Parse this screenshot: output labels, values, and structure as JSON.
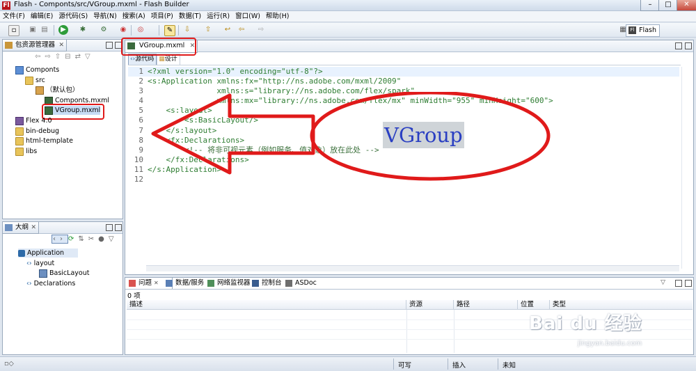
{
  "window": {
    "title": "Flash - Componts/src/VGroup.mxml - Flash Builder",
    "logo": "Fl",
    "controls": [
      "–",
      "□",
      "✕"
    ]
  },
  "menu": [
    "文件(F)",
    "编辑(E)",
    "源代码(S)",
    "导航(N)",
    "搜索(A)",
    "项目(P)",
    "数据(T)",
    "运行(R)",
    "窗口(W)",
    "帮助(H)"
  ],
  "toolbar": {
    "perspective_label": "Flash",
    "perspective_icon": "Fl"
  },
  "package_explorer": {
    "tab_label": "包资源管理器",
    "tree": [
      {
        "label": "Componts",
        "icon": "project-icon"
      },
      {
        "label": "src",
        "icon": "folder-icon"
      },
      {
        "label": "（默认包）",
        "icon": "package-icon"
      },
      {
        "label": "Componts.mxml",
        "icon": "mxml-file-icon"
      },
      {
        "label": "VGroup.mxml",
        "icon": "mxml-file-icon"
      },
      {
        "label": "Flex 4.0",
        "icon": "library-icon"
      },
      {
        "label": "bin-debug",
        "icon": "folder-icon"
      },
      {
        "label": "html-template",
        "icon": "folder-icon"
      },
      {
        "label": "libs",
        "icon": "folder-icon"
      }
    ]
  },
  "outline": {
    "tab_label": "大纲",
    "tree": [
      {
        "label": "Application"
      },
      {
        "label": "layout"
      },
      {
        "label": "BasicLayout"
      },
      {
        "label": "Declarations"
      }
    ]
  },
  "editor": {
    "tab_label": "VGroup.mxml",
    "mode_source": "源代码",
    "mode_design": "设计",
    "lines": [
      {
        "n": "1",
        "text": "<?xml version=\"1.0\" encoding=\"utf-8\"?>"
      },
      {
        "n": "2",
        "text": "<s:Application xmlns:fx=\"http://ns.adobe.com/mxml/2009\""
      },
      {
        "n": "3",
        "text": "               xmlns:s=\"library://ns.adobe.com/flex/spark\""
      },
      {
        "n": "4",
        "text": "               xmlns:mx=\"library://ns.adobe.com/flex/mx\" minWidth=\"955\" minHeight=\"600\">"
      },
      {
        "n": "5",
        "text": "    <s:layout>"
      },
      {
        "n": "6",
        "text": "        <s:BasicLayout/>"
      },
      {
        "n": "7",
        "text": "    </s:layout>"
      },
      {
        "n": "8",
        "text": "    <fx:Declarations>"
      },
      {
        "n": "9",
        "text": "        <!-- 将非可视元素（例如服务、值对象）放在此处 -->"
      },
      {
        "n": "10",
        "text": "    </fx:Declarations>"
      },
      {
        "n": "11",
        "text": "</s:Application>"
      },
      {
        "n": "12",
        "text": ""
      }
    ],
    "annotation_text": "VGroup"
  },
  "bottom_panel": {
    "tabs": [
      "问题",
      "数据/服务",
      "网络监视器",
      "控制台",
      "ASDoc"
    ],
    "count": "0 项",
    "columns": [
      "描述",
      "资源",
      "路径",
      "位置",
      "类型"
    ]
  },
  "status_bar": {
    "writable": "可写",
    "insert": "插入",
    "unknown": "未知"
  },
  "watermark": {
    "brand": "Bai du 经验",
    "url": "jingyan.baidu.com"
  },
  "colors": {
    "annotation_red": "#e01a1a",
    "selection_blue": "#c7dcf5"
  }
}
